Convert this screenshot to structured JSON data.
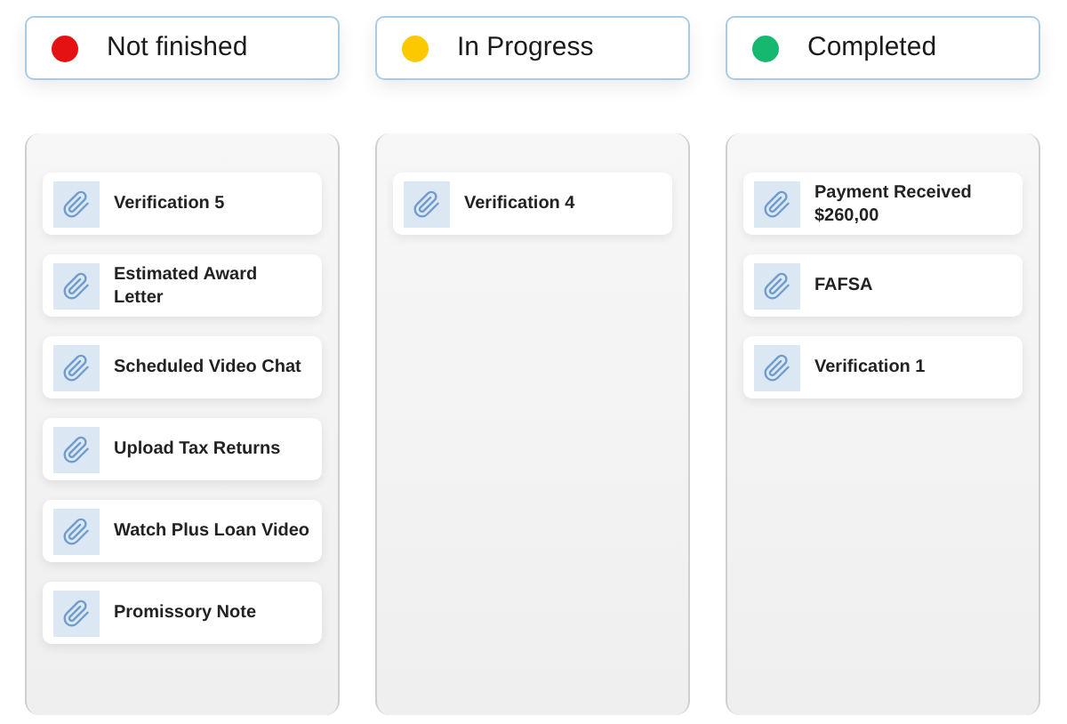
{
  "columns": [
    {
      "status": "Not finished",
      "color": "#e41212",
      "cards": [
        {
          "title": "Verification 5"
        },
        {
          "title": "Estimated Award Letter"
        },
        {
          "title": "Scheduled Video Chat"
        },
        {
          "title": "Upload Tax Returns"
        },
        {
          "title": "Watch Plus Loan Video"
        },
        {
          "title": "Promissory Note"
        }
      ]
    },
    {
      "status": "In Progress",
      "color": "#fcc800",
      "cards": [
        {
          "title": "Verification 4"
        }
      ]
    },
    {
      "status": "Completed",
      "color": "#14b86e",
      "cards": [
        {
          "title": "Payment Received\n$260,00"
        },
        {
          "title": "FAFSA"
        },
        {
          "title": "Verification 1"
        }
      ]
    }
  ]
}
